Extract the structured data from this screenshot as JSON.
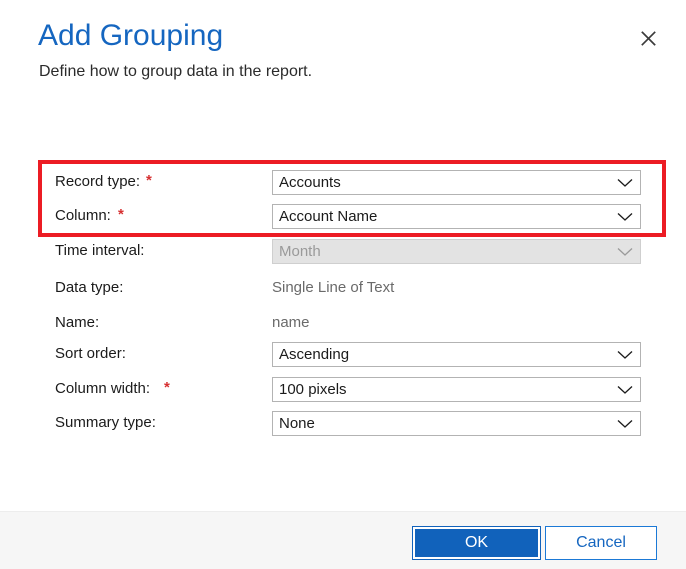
{
  "dialog": {
    "title": "Add Grouping",
    "subtitle": "Define how to group data in the report.",
    "close_icon": "close-icon"
  },
  "form": {
    "rows": [
      {
        "label": "Record type:",
        "required": true,
        "control": "dropdown",
        "value": "Accounts",
        "disabled": false,
        "name": "record-type"
      },
      {
        "label": "Column:",
        "required": true,
        "control": "dropdown",
        "value": "Account Name",
        "disabled": false,
        "name": "column"
      },
      {
        "label": "Time interval:",
        "required": false,
        "control": "dropdown",
        "value": "Month",
        "disabled": true,
        "name": "time-interval"
      },
      {
        "label": "Data type:",
        "required": false,
        "control": "static",
        "value": "Single Line of Text",
        "disabled": false,
        "name": "data-type"
      },
      {
        "label": "Name:",
        "required": false,
        "control": "static",
        "value": "name",
        "disabled": false,
        "name": "name"
      },
      {
        "label": "Sort order:",
        "required": false,
        "control": "dropdown",
        "value": "Ascending",
        "disabled": false,
        "name": "sort-order"
      },
      {
        "label": "Column width:",
        "required": true,
        "control": "dropdown",
        "value": "100 pixels",
        "disabled": false,
        "name": "column-width"
      },
      {
        "label": "Summary type:",
        "required": false,
        "control": "dropdown",
        "value": "None",
        "disabled": false,
        "name": "summary-type"
      }
    ],
    "required_marker": "*"
  },
  "footer": {
    "ok_label": "OK",
    "cancel_label": "Cancel"
  },
  "annotations": {
    "required_fields_box": "red-highlight-required-fields",
    "ok_button_box": "red-highlight-ok-button",
    "color": "#ec1c24"
  },
  "colors": {
    "title_blue": "#1566c0",
    "primary_button": "#1162bb",
    "link_blue": "#1566c0",
    "required_star": "#d63031",
    "footer_background": "#f6f6f6",
    "disabled_field": "#e3e3e3"
  }
}
